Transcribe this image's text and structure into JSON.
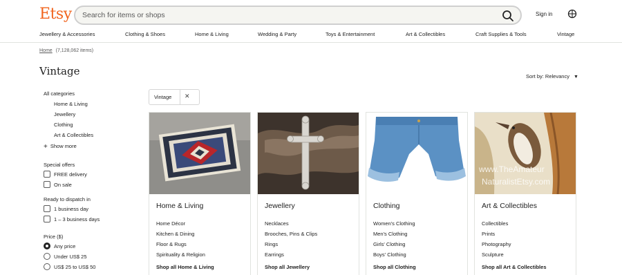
{
  "header": {
    "logo": "Etsy",
    "search_placeholder": "Search for items or shops",
    "signin": "Sign in",
    "nav": [
      "Jewellery & Accessories",
      "Clothing & Shoes",
      "Home & Living",
      "Wedding & Party",
      "Toys & Entertainment",
      "Art & Collectibles",
      "Craft Supplies & Tools",
      "Vintage"
    ]
  },
  "breadcrumb": {
    "home": "Home",
    "count": "(7,128,062 items)"
  },
  "page_title": "Vintage",
  "sort_label": "Sort by: Relevancy",
  "sidebar": {
    "all_categories": "All categories",
    "categories": [
      "Home & Living",
      "Jewellery",
      "Clothing",
      "Art & Collectibles"
    ],
    "show_more": "Show more",
    "special_offers": {
      "heading": "Special offers",
      "options": [
        "FREE delivery",
        "On sale"
      ]
    },
    "dispatch": {
      "heading": "Ready to dispatch in",
      "options": [
        "1 business day",
        "1 – 3 business days"
      ]
    },
    "price": {
      "heading": "Price ($)",
      "options": [
        "Any price",
        "Under US$ 25",
        "US$ 25 to US$ 50"
      ],
      "selected": 0
    }
  },
  "chip": {
    "label": "Vintage"
  },
  "cards": [
    {
      "title": "Home & Living",
      "links": [
        "Home Décor",
        "Kitchen & Dining",
        "Floor & Rugs",
        "Spirituality & Religion"
      ],
      "shop_all": "Shop all Home & Living"
    },
    {
      "title": "Jewellery",
      "links": [
        "Necklaces",
        "Brooches, Pins & Clips",
        "Rings",
        "Earrings"
      ],
      "shop_all": "Shop all Jewellery"
    },
    {
      "title": "Clothing",
      "links": [
        "Women's Clothing",
        "Men's Clothing",
        "Girls' Clothing",
        "Boys' Clothing"
      ],
      "shop_all": "Shop all Clothing"
    },
    {
      "title": "Art & Collectibles",
      "links": [
        "Collectibles",
        "Prints",
        "Photography",
        "Sculpture"
      ],
      "shop_all": "Shop all Art & Collectibles",
      "image_watermark": [
        "www.TheAmateur",
        "NaturalistEtsy.com"
      ]
    }
  ],
  "colors": {
    "brand": "#f1641e",
    "text": "#222222",
    "border": "#e1e3df"
  }
}
